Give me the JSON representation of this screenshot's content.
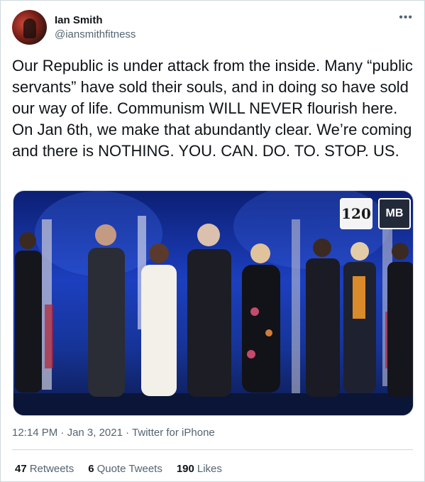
{
  "author": {
    "display_name": "Ian Smith",
    "handle": "@iansmithfitness",
    "avatar_icon": "profile-avatar"
  },
  "more_icon": "ellipsis-icon",
  "tweet": {
    "text": "Our Republic is under attack from the inside. Many “public servants” have sold their souls, and in doing so have sold our way of life. Communism WILL NEVER flourish here. On Jan 6th, we make that abundantly clear. We’re coming and there is NOTHING. YOU. CAN. DO. TO. STOP. US."
  },
  "media": {
    "logos": [
      "120",
      "MB"
    ]
  },
  "meta": {
    "time": "12:14 PM",
    "separator": " · ",
    "date": "Jan 3, 2021",
    "source": "Twitter for iPhone"
  },
  "stats": {
    "retweets_count": "47",
    "retweets_label": "Retweets",
    "quotes_count": "6",
    "quotes_label": "Quote Tweets",
    "likes_count": "190",
    "likes_label": "Likes"
  },
  "colors": {
    "text": "#0f1419",
    "secondary": "#536471",
    "border": "#cfd9de",
    "stage_blue": "#1c3fbf"
  }
}
